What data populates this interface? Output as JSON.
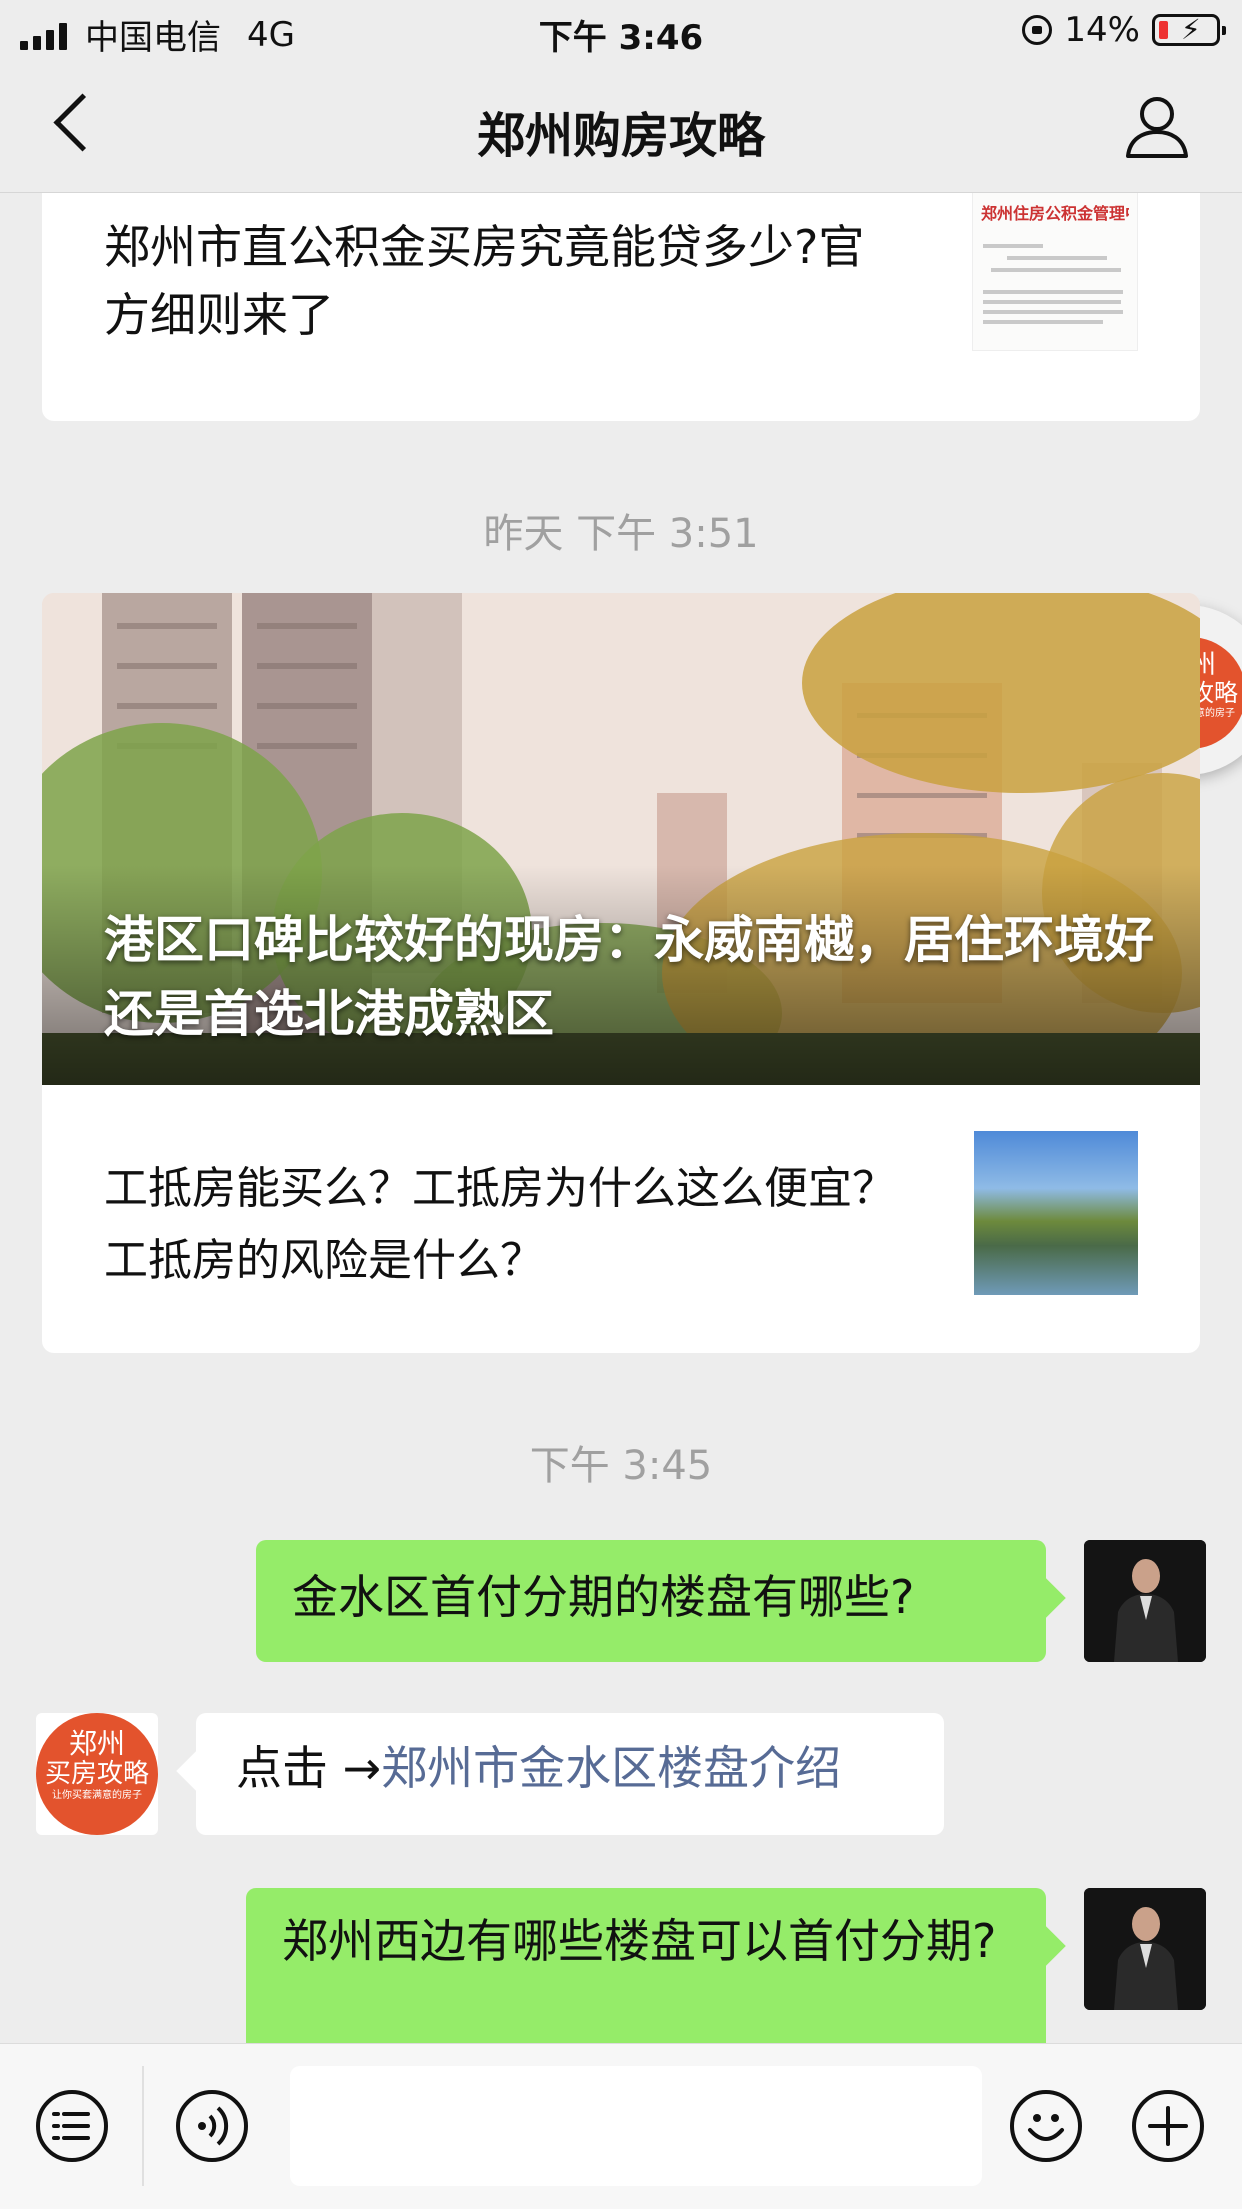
{
  "status_bar": {
    "carrier": "中国电信",
    "network": "4G",
    "time": "下午 3:46",
    "battery": "14%"
  },
  "nav": {
    "title": "郑州购房攻略"
  },
  "messages": {
    "article1": {
      "title": "郑州市直公积金买房究竟能贷多少?官方细则来了",
      "thumb_header": "郑州住房公积金管理中心文件"
    },
    "timestamp1": "昨天 下午 3:51",
    "article2": {
      "hero_title": "港区口碑比较好的现房：永威南樾，居住环境好还是首选北港成熟区",
      "sub_title": "工抵房能买么？工抵房为什么这么便宜？工抵房的风险是什么？"
    },
    "timestamp2": "下午 3:45",
    "msg1": "金水区首付分期的楼盘有哪些?",
    "reply_prefix": "点击 →",
    "reply_link": "郑州市金水区楼盘介绍",
    "msg2": "郑州西边有哪些楼盘可以首付分期?"
  },
  "brand": {
    "line1": "郑州",
    "line2": "买房攻略",
    "slogan": "让你买套满意的房子",
    "color": "#e3532d"
  },
  "colors": {
    "bubble_green": "#95ec69",
    "link": "#576b95",
    "background": "#ededed"
  },
  "icons": {
    "back": "back-icon",
    "profile": "profile-icon",
    "menu": "menu-icon",
    "voice": "voice-icon",
    "emoji": "emoji-icon",
    "plus": "plus-icon"
  }
}
